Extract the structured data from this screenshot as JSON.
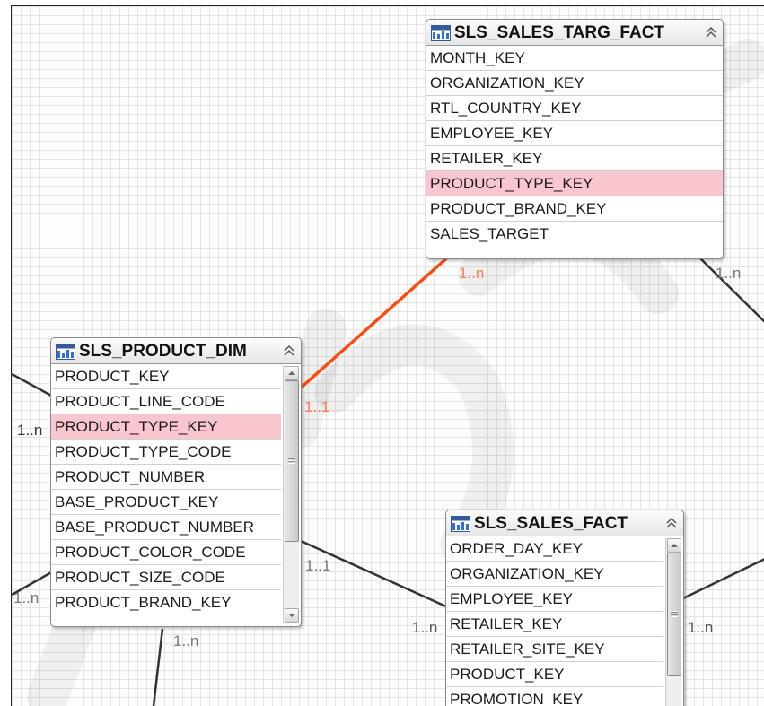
{
  "tables": {
    "targ_fact": {
      "title": "SLS_SALES_TARG_FACT",
      "rows": [
        "MONTH_KEY",
        "ORGANIZATION_KEY",
        "RTL_COUNTRY_KEY",
        "EMPLOYEE_KEY",
        "RETAILER_KEY",
        "PRODUCT_TYPE_KEY",
        "PRODUCT_BRAND_KEY",
        "SALES_TARGET"
      ],
      "highlighted_row": "PRODUCT_TYPE_KEY"
    },
    "product_dim": {
      "title": "SLS_PRODUCT_DIM",
      "rows": [
        "PRODUCT_KEY",
        "PRODUCT_LINE_CODE",
        "PRODUCT_TYPE_KEY",
        "PRODUCT_TYPE_CODE",
        "PRODUCT_NUMBER",
        "BASE_PRODUCT_KEY",
        "BASE_PRODUCT_NUMBER",
        "PRODUCT_COLOR_CODE",
        "PRODUCT_SIZE_CODE",
        "PRODUCT_BRAND_KEY"
      ],
      "highlighted_row": "PRODUCT_TYPE_KEY"
    },
    "sales_fact": {
      "title": "SLS_SALES_FACT",
      "rows": [
        "ORDER_DAY_KEY",
        "ORGANIZATION_KEY",
        "EMPLOYEE_KEY",
        "RETAILER_KEY",
        "RETAILER_SITE_KEY",
        "PRODUCT_KEY",
        "PROMOTION_KEY"
      ]
    }
  },
  "cardinalities": {
    "targ_fact_left": "1..n",
    "targ_fact_right": "1..n",
    "product_dim_to_targ": "1..1",
    "product_dim_left_upper": "1..n",
    "product_dim_left_lower": "1..n",
    "product_dim_to_sales": "1..1",
    "product_dim_bottom": "1..n",
    "sales_fact_left": "1..n",
    "sales_fact_right": "1..n"
  },
  "colors": {
    "highlight_row": "#f9c5cf",
    "active_link": "#ff4b12",
    "link": "#333333",
    "cardinality_active": "#ff7a55",
    "cardinality": "#777777"
  },
  "icons": {
    "table": "table-icon",
    "collapse": "collapse-chevron-icon",
    "scroll_up": "scroll-up-arrow-icon",
    "scroll_down": "scroll-down-arrow-icon"
  }
}
